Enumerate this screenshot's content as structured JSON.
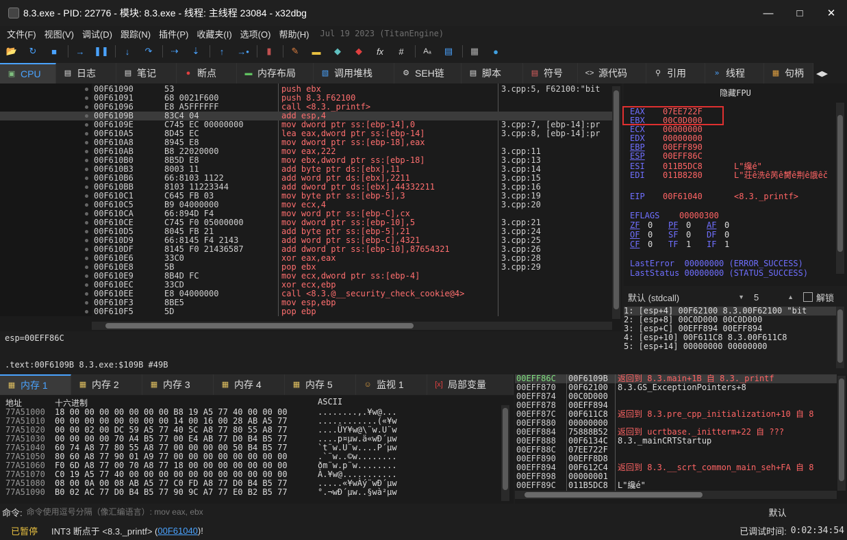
{
  "window": {
    "title": "8.3.exe - PID: 22776 - 模块: 8.3.exe - 线程: 主线程 23084 - x32dbg"
  },
  "menu": {
    "items": [
      "文件(F)",
      "视图(V)",
      "调试(D)",
      "跟踪(N)",
      "插件(P)",
      "收藏夹(I)",
      "选项(O)",
      "帮助(H)"
    ],
    "build": "Jul 19 2023 (TitanEngine)"
  },
  "toolbar": {
    "icons": [
      "open-folder-icon",
      "restart-icon",
      "stop-icon",
      "run-icon",
      "pause-icon",
      "step-into-icon",
      "step-over-icon",
      "trace-into-icon",
      "trace-over-icon",
      "run-to-user-icon",
      "execute-till-return-icon",
      "patch-icon",
      "comment-icon",
      "label-icon",
      "bookmark-icon",
      "function-icon",
      "fx-icon",
      "hash-icon",
      "font-icon",
      "ref-icon",
      "calculator-icon",
      "globe-icon"
    ]
  },
  "tabs": [
    {
      "label": "CPU",
      "icon": "cpu-icon"
    },
    {
      "label": "日志",
      "icon": "log-icon"
    },
    {
      "label": "笔记",
      "icon": "notes-icon"
    },
    {
      "label": "断点",
      "icon": "breakpoint-icon"
    },
    {
      "label": "内存布局",
      "icon": "memory-map-icon"
    },
    {
      "label": "调用堆栈",
      "icon": "call-stack-icon"
    },
    {
      "label": "SEH链",
      "icon": "seh-icon"
    },
    {
      "label": "脚本",
      "icon": "script-icon"
    },
    {
      "label": "符号",
      "icon": "symbols-icon"
    },
    {
      "label": "源代码",
      "icon": "source-icon"
    },
    {
      "label": "引用",
      "icon": "references-icon"
    },
    {
      "label": "线程",
      "icon": "threads-icon"
    },
    {
      "label": "句柄",
      "icon": "handles-icon"
    }
  ],
  "disasm": [
    {
      "addr": "00F61090",
      "bytes": "53",
      "ins": "push ebx",
      "cmt": "3.cpp:5, F62100:\"bit"
    },
    {
      "addr": "00F61091",
      "bytes": "68 0021F600",
      "ins": "push 8.3.F62100",
      "cmt": ""
    },
    {
      "addr": "00F61096",
      "bytes": "E8 A5FFFFFF",
      "ins": "call <8.3._printf>",
      "cmt": ""
    },
    {
      "addr": "00F6109B",
      "bytes": "83C4 04",
      "ins": "add esp,4",
      "cmt": ""
    },
    {
      "addr": "00F6109E",
      "bytes": "C745 EC 00000000",
      "ins": "mov dword ptr ss:[ebp-14],0",
      "cmt": "3.cpp:7, [ebp-14]:pr"
    },
    {
      "addr": "00F610A5",
      "bytes": "8D45 EC",
      "ins": "lea eax,dword ptr ss:[ebp-14]",
      "cmt": "3.cpp:8, [ebp-14]:pr"
    },
    {
      "addr": "00F610A8",
      "bytes": "8945 E8",
      "ins": "mov dword ptr ss:[ebp-18],eax",
      "cmt": ""
    },
    {
      "addr": "00F610AB",
      "bytes": "B8 22020000",
      "ins": "mov eax,222",
      "cmt": "3.cpp:11"
    },
    {
      "addr": "00F610B0",
      "bytes": "8B5D E8",
      "ins": "mov ebx,dword ptr ss:[ebp-18]",
      "cmt": "3.cpp:13"
    },
    {
      "addr": "00F610B3",
      "bytes": "8003 11",
      "ins": "add byte ptr ds:[ebx],11",
      "cmt": "3.cpp:14"
    },
    {
      "addr": "00F610B6",
      "bytes": "66:8103 1122",
      "ins": "add word ptr ds:[ebx],2211",
      "cmt": "3.cpp:15"
    },
    {
      "addr": "00F610BB",
      "bytes": "8103 11223344",
      "ins": "add dword ptr ds:[ebx],44332211",
      "cmt": "3.cpp:16"
    },
    {
      "addr": "00F610C1",
      "bytes": "C645 FB 03",
      "ins": "mov byte ptr ss:[ebp-5],3",
      "cmt": "3.cpp:19"
    },
    {
      "addr": "00F610C5",
      "bytes": "B9 04000000",
      "ins": "mov ecx,4",
      "cmt": "3.cpp:20"
    },
    {
      "addr": "00F610CA",
      "bytes": "66:894D F4",
      "ins": "mov word ptr ss:[ebp-C],cx",
      "cmt": ""
    },
    {
      "addr": "00F610CE",
      "bytes": "C745 F0 05000000",
      "ins": "mov dword ptr ss:[ebp-10],5",
      "cmt": "3.cpp:21"
    },
    {
      "addr": "00F610D5",
      "bytes": "8045 FB 21",
      "ins": "add byte ptr ss:[ebp-5],21",
      "cmt": "3.cpp:24"
    },
    {
      "addr": "00F610D9",
      "bytes": "66:8145 F4 2143",
      "ins": "add word ptr ss:[ebp-C],4321",
      "cmt": "3.cpp:25"
    },
    {
      "addr": "00F610DF",
      "bytes": "8145 F0 21436587",
      "ins": "add dword ptr ss:[ebp-10],87654321",
      "cmt": "3.cpp:26"
    },
    {
      "addr": "00F610E6",
      "bytes": "33C0",
      "ins": "xor eax,eax",
      "cmt": "3.cpp:28"
    },
    {
      "addr": "00F610E8",
      "bytes": "5B",
      "ins": "pop ebx",
      "cmt": "3.cpp:29"
    },
    {
      "addr": "00F610E9",
      "bytes": "8B4D FC",
      "ins": "mov ecx,dword ptr ss:[ebp-4]",
      "cmt": ""
    },
    {
      "addr": "00F610EC",
      "bytes": "33CD",
      "ins": "xor ecx,ebp",
      "cmt": ""
    },
    {
      "addr": "00F610EE",
      "bytes": "E8 04000000",
      "ins": "call <8.3.@__security_check_cookie@4>",
      "cmt": ""
    },
    {
      "addr": "00F610F3",
      "bytes": "8BE5",
      "ins": "mov esp,ebp",
      "cmt": ""
    },
    {
      "addr": "00F610F5",
      "bytes": "5D",
      "ins": "pop ebp",
      "cmt": ""
    }
  ],
  "info": {
    "line1": "esp=00EFF86C",
    "line2": ".text:00F6109B 8.3.exe:$109B #49B"
  },
  "registers": {
    "header": "隐藏FPU",
    "regs": [
      {
        "n": "EAX",
        "v": "07EE722F",
        "d": ""
      },
      {
        "n": "EBX",
        "v": "00C0D000",
        "d": ""
      },
      {
        "n": "ECX",
        "v": "00000000",
        "d": ""
      },
      {
        "n": "EDX",
        "v": "00000000",
        "d": ""
      },
      {
        "n": "EBP",
        "v": "00EFF890",
        "d": ""
      },
      {
        "n": "ESP",
        "v": "00EFF86C",
        "d": ""
      },
      {
        "n": "ESI",
        "v": "011B5DC8",
        "d": "L\"纔é\""
      },
      {
        "n": "EDI",
        "v": "011B8280",
        "d": "L\"荘ê洗ê苪ê膥ê荆ê誐êč"
      }
    ],
    "eip": {
      "n": "EIP",
      "v": "00F61040",
      "d": "<8.3._printf>"
    },
    "eflags": {
      "n": "EFLAGS",
      "v": "00000300"
    },
    "flags": [
      [
        "ZF",
        "0",
        "PF",
        "0",
        "AF",
        "0"
      ],
      [
        "OF",
        "0",
        "SF",
        "0",
        "DF",
        "0"
      ],
      [
        "CF",
        "0",
        "TF",
        "1",
        "IF",
        "1"
      ]
    ],
    "lasterror": "LastError  00000000 (ERROR_SUCCESS)",
    "laststatus": "LastStatus 00000000 (STATUS_SUCCESS)"
  },
  "callconv": {
    "label": "默认 (stdcall)",
    "count": "5",
    "unlock": "解锁"
  },
  "stackargs": [
    "1: [esp+4] 00F62100 8.3.00F62100 \"bit",
    "2: [esp+8] 00C0D000 00C0D000",
    "3: [esp+C] 00EFF894 00EFF894",
    "4: [esp+10] 00F611C8 8.3.00F611C8",
    "5: [esp+14] 00000000 00000000"
  ],
  "bottomtabs": [
    {
      "label": "内存 1",
      "icon": "memory-icon"
    },
    {
      "label": "内存 2",
      "icon": "memory-icon"
    },
    {
      "label": "内存 3",
      "icon": "memory-icon"
    },
    {
      "label": "内存 4",
      "icon": "memory-icon"
    },
    {
      "label": "内存 5",
      "icon": "memory-icon"
    },
    {
      "label": "监视 1",
      "icon": "watch-icon"
    },
    {
      "label": "局部变量",
      "icon": "locals-icon"
    }
  ],
  "dump": {
    "headers": {
      "addr": "地址",
      "hex": "十六进制",
      "ascii": "ASCII"
    },
    "rows": [
      {
        "a": "77A51000",
        "h": "18 00 00 00 00 00 00 00 B8 19 A5 77 40 00 00 00",
        "s": "........,.¥w@..."
      },
      {
        "a": "77A51010",
        "h": "00 00 00 00 00 00 00 00 14 00 16 00 28 AB A5 77",
        "s": "............(«¥w"
      },
      {
        "a": "77A51020",
        "h": "00 00 02 00 DC 59 A5 77 40 5C A8 77 80 55 A8 77",
        "s": "....ÜY¥w@\\¨w.U¨w"
      },
      {
        "a": "77A51030",
        "h": "00 00 00 00 70 A4 B5 77 00 E4 AB 77 D0 B4 B5 77",
        "s": "....p¤µw.ä«wÐ´µw"
      },
      {
        "a": "77A51040",
        "h": "60 74 A8 77 80 55 A8 77 00 00 00 00 50 B4 B5 77",
        "s": "`t¨w.U¨w....P´µw"
      },
      {
        "a": "77A51050",
        "h": "80 60 A8 77 90 01 A9 77 00 00 00 00 00 00 00 00",
        "s": ".`¨w..©w........"
      },
      {
        "a": "77A51060",
        "h": "F0 6D A8 77 00 70 A8 77 18 00 00 00 00 00 00 00",
        "s": "ðm¨w.p¨w........"
      },
      {
        "a": "77A51070",
        "h": "C0 19 A5 77 40 00 00 00 00 00 00 00 00 00 00 00",
        "s": "À.¥w@..........."
      },
      {
        "a": "77A51080",
        "h": "08 00 0A 00 08 AB A5 77 C0 FD A8 77 D0 B4 B5 77",
        "s": ".....«¥wÀý¨wÐ´µw"
      },
      {
        "a": "77A51090",
        "h": "B0 02 AC 77 D0 B4 B5 77 90 9C A7 77 E0 B2 B5 77",
        "s": "°.¬wÐ´µw..§wà²µw"
      }
    ]
  },
  "stack": [
    {
      "a": "00EFF86C",
      "v": "00F6109B",
      "c": "返回到 8.3.main+1B 自 8.3._printf",
      "sel": true
    },
    {
      "a": "00EFF870",
      "v": "00F62100",
      "c": "8.3.GS_ExceptionPointers+8",
      "sel": false
    },
    {
      "a": "00EFF874",
      "v": "00C0D000",
      "c": "",
      "sel": false
    },
    {
      "a": "00EFF878",
      "v": "00EFF894",
      "c": "",
      "sel": false
    },
    {
      "a": "00EFF87C",
      "v": "00F611C8",
      "c": "返回到 8.3.pre_cpp_initialization+10 自 8",
      "sel": false
    },
    {
      "a": "00EFF880",
      "v": "00000000",
      "c": "",
      "sel": false
    },
    {
      "a": "00EFF884",
      "v": "75888B52",
      "c": "返回到 ucrtbase._initterm+22 自 ???",
      "sel": false
    },
    {
      "a": "00EFF888",
      "v": "00F6134C",
      "c": "8.3._mainCRTStartup",
      "sel": false
    },
    {
      "a": "00EFF88C",
      "v": "07EE722F",
      "c": "",
      "sel": false
    },
    {
      "a": "00EFF890",
      "v": "00EFF8D8",
      "c": "",
      "sel": false
    },
    {
      "a": "00EFF894",
      "v": "00F612C4",
      "c": "返回到 8.3.__scrt_common_main_seh+FA 自 8",
      "sel": false
    },
    {
      "a": "00EFF898",
      "v": "00000001",
      "c": "",
      "sel": false
    },
    {
      "a": "00EFF89C",
      "v": "011B5DC8",
      "c": "L\"纔é\"",
      "sel": false
    }
  ],
  "command": {
    "label": "命令:",
    "placeholder": "命令使用逗号分隔（像汇编语言）: mov eax, ebx",
    "mode": "默认"
  },
  "status": {
    "state": "已暂停",
    "msg_prefix": "INT3 断点于 <8.3._printf> (",
    "msg_link": "00F61040",
    "msg_suffix": ")!",
    "time_label": "已调试时间:",
    "time": "0:02:34:54"
  },
  "colors": {
    "accent": "#4aa3ff",
    "paused": "#e8c040",
    "instruction": "#ff6f6f",
    "register": "#6f6fff"
  }
}
